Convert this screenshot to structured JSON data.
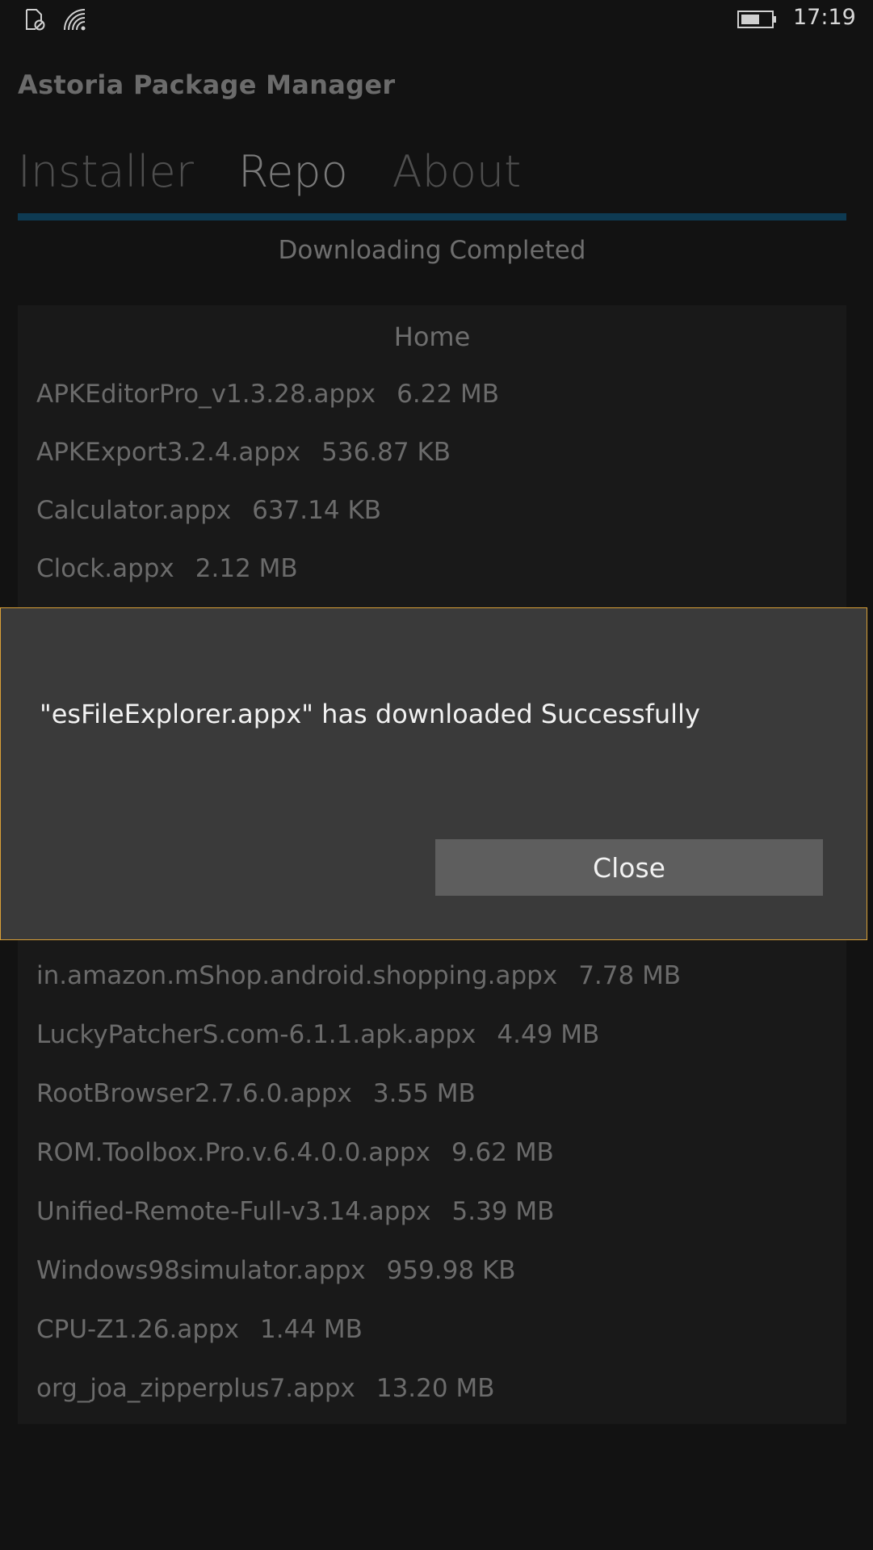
{
  "status_bar": {
    "time": "17:19",
    "icons": [
      "no-sim-icon",
      "wifi-icon",
      "battery-icon"
    ]
  },
  "app": {
    "title": "Astoria Package Manager"
  },
  "tabs": [
    {
      "label": "Installer",
      "active": false
    },
    {
      "label": "Repo",
      "active": true
    },
    {
      "label": "About",
      "active": false
    }
  ],
  "download": {
    "status": "Downloading Completed",
    "progress": 1.0
  },
  "repo": {
    "header": "Home",
    "items_above": [
      {
        "name": "APKEditorPro_v1.3.28.appx",
        "size": "6.22 MB"
      },
      {
        "name": "APKExport3.2.4.appx",
        "size": "536.87 KB"
      },
      {
        "name": "Calculator.appx",
        "size": "637.14 KB"
      },
      {
        "name": "Clock.appx",
        "size": "2.12 MB"
      }
    ],
    "items_below": [
      {
        "name": "in.amazon.mShop.android.shopping.appx",
        "size": "7.78 MB"
      },
      {
        "name": "LuckyPatcherS.com-6.1.1.apk.appx",
        "size": "4.49 MB"
      },
      {
        "name": "RootBrowser2.7.6.0.appx",
        "size": "3.55 MB"
      },
      {
        "name": "ROM.Toolbox.Pro.v.6.4.0.0.appx",
        "size": "9.62 MB"
      },
      {
        "name": "Unified-Remote-Full-v3.14.appx",
        "size": "5.39 MB"
      },
      {
        "name": "Windows98simulator.appx",
        "size": "959.98 KB"
      },
      {
        "name": "CPU-Z1.26.appx",
        "size": "1.44 MB"
      },
      {
        "name": "org_joa_zipperplus7.appx",
        "size": "13.20 MB"
      }
    ]
  },
  "dialog": {
    "message": "\"esFileExplorer.appx\" has downloaded Successfully",
    "close_label": "Close"
  },
  "colors": {
    "background": "#121212",
    "dialog_bg": "#3a3a3a",
    "dialog_border": "#d9a037",
    "accent": "#0e3a52"
  }
}
